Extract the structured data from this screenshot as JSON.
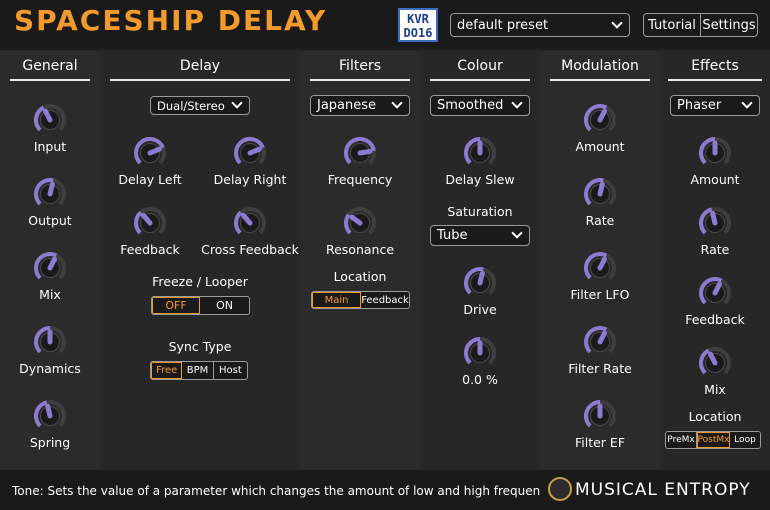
{
  "header": {
    "title": "SPACESHIP DELAY",
    "logo_text": "KVR DO16",
    "preset": "default preset",
    "tutorial": "Tutorial",
    "settings": "Settings"
  },
  "panels": {
    "general": {
      "title": "General",
      "knobs": [
        {
          "label": "Input",
          "value": 0.4
        },
        {
          "label": "Output",
          "value": 0.55
        },
        {
          "label": "Mix",
          "value": 0.6
        },
        {
          "label": "Dynamics",
          "value": 0.5
        },
        {
          "label": "Spring",
          "value": 0.45
        }
      ]
    },
    "delay": {
      "title": "Delay",
      "mode": "Dual/Stereo",
      "knobs": [
        {
          "label": "Delay Left",
          "value": 0.75
        },
        {
          "label": "Delay Right",
          "value": 0.75
        },
        {
          "label": "Feedback",
          "value": 0.35
        },
        {
          "label": "Cross Feedback",
          "value": 0.35
        }
      ],
      "freeze_title": "Freeze / Looper",
      "freeze": [
        "OFF",
        "ON"
      ],
      "sync_title": "Sync Type",
      "sync": [
        "Free",
        "BPM",
        "Host"
      ]
    },
    "filters": {
      "title": "Filters",
      "mode": "Japanese",
      "knobs": [
        {
          "label": "Frequency",
          "value": 0.8
        },
        {
          "label": "Resonance",
          "value": 0.3
        }
      ],
      "location_title": "Location",
      "location": [
        "Main",
        "Feedback"
      ]
    },
    "colour": {
      "title": "Colour",
      "mode": "Smoothed",
      "knobs": [
        {
          "label": "Delay Slew",
          "value": 0.5
        }
      ],
      "saturation_title": "Saturation",
      "saturation": "Tube",
      "knobs2": [
        {
          "label": "Drive",
          "value": 0.55
        },
        {
          "label": "0.0 %",
          "value": 0.5
        }
      ]
    },
    "modulation": {
      "title": "Modulation",
      "knobs": [
        {
          "label": "Amount",
          "value": 0.6
        },
        {
          "label": "Rate",
          "value": 0.55
        },
        {
          "label": "Filter LFO",
          "value": 0.6
        },
        {
          "label": "Filter Rate",
          "value": 0.6
        },
        {
          "label": "Filter EF",
          "value": 0.5
        }
      ]
    },
    "effects": {
      "title": "Effects",
      "mode": "Phaser",
      "knobs": [
        {
          "label": "Amount",
          "value": 0.5
        },
        {
          "label": "Rate",
          "value": 0.45
        },
        {
          "label": "Feedback",
          "value": 0.6
        },
        {
          "label": "Mix",
          "value": 0.4
        }
      ],
      "location_title": "Location",
      "location": [
        "PreMx",
        "PostMx",
        "Loop"
      ]
    }
  },
  "status": {
    "text": "Tone: Sets the value of a parameter which changes the amount of low and high frequency c",
    "brand": "MUSICAL ENTROPY"
  },
  "colors": {
    "accent": "#f29a2e",
    "knob": "#8d7bd2",
    "bg": "#1c1c1c",
    "panel": "#2b2b2b"
  }
}
